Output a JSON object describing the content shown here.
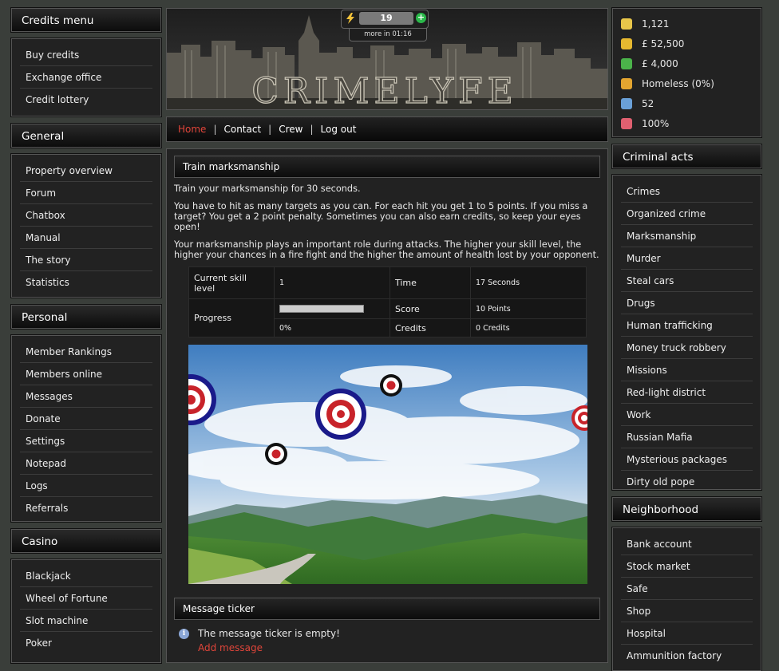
{
  "left": {
    "sections": [
      {
        "title": "Credits menu",
        "items": [
          "Buy credits",
          "Exchange office",
          "Credit lottery"
        ]
      },
      {
        "title": "General",
        "items": [
          "Property overview",
          "Forum",
          "Chatbox",
          "Manual",
          "The story",
          "Statistics"
        ]
      },
      {
        "title": "Personal",
        "items": [
          "Member Rankings",
          "Members online",
          "Messages",
          "Donate",
          "Settings",
          "Notepad",
          "Logs",
          "Referrals"
        ]
      },
      {
        "title": "Casino",
        "items": [
          "Blackjack",
          "Wheel of Fortune",
          "Slot machine",
          "Poker"
        ]
      }
    ]
  },
  "header": {
    "energy_value": "19",
    "energy_timer": "more in 01:16",
    "logo_text": "CRIMELYFE"
  },
  "nav": {
    "home": "Home",
    "contact": "Contact",
    "crew": "Crew",
    "logout": "Log out"
  },
  "main": {
    "title": "Train marksmanship",
    "p1": "Train your marksmanship for 30 seconds.",
    "p2": "You have to hit as many targets as you can. For each hit you get 1 to 5 points. If you miss a target? You get a 2 point penalty. Sometimes you can also earn credits, so keep your eyes open!",
    "p3": "Your marksmanship plays an important role during attacks. The higher your skill level, the higher your chances in a fire fight and the higher the amount of health lost by your opponent.",
    "table": {
      "skill_label": "Current skill level",
      "skill_value": "1",
      "time_label": "Time",
      "time_value": "17 Seconds",
      "progress_label": "Progress",
      "progress_value": "0%",
      "progress_fraction": 0.0,
      "score_label": "Score",
      "score_value": "10 Points",
      "credits_label": "Credits",
      "credits_value": "0 Credits"
    },
    "ticker_title": "Message ticker",
    "ticker_empty": "The message ticker is empty!",
    "add_message": "Add message"
  },
  "right": {
    "stats": [
      {
        "icon": "shield-icon",
        "color": "#e8c64a",
        "value": "1,121"
      },
      {
        "icon": "money-bag-icon",
        "color": "#e6b830",
        "value": "£ 52,500"
      },
      {
        "icon": "banknote-icon",
        "color": "#4bb34a",
        "value": "£ 4,000"
      },
      {
        "icon": "medal-icon",
        "color": "#e3a530",
        "value": "Homeless (0%)"
      },
      {
        "icon": "telephone-icon",
        "color": "#6aa0d8",
        "value": "52"
      },
      {
        "icon": "heart-icon",
        "color": "#e06070",
        "value": "100%"
      }
    ],
    "sections": [
      {
        "title": "Criminal acts",
        "items": [
          "Crimes",
          "Organized crime",
          "Marksmanship",
          "Murder",
          "Steal cars",
          "Drugs",
          "Human trafficking",
          "Money truck robbery",
          "Missions",
          "Red-light district",
          "Work",
          "Russian Mafia",
          "Mysterious packages",
          "Dirty old pope"
        ]
      },
      {
        "title": "Neighborhood",
        "items": [
          "Bank account",
          "Stock market",
          "Safe",
          "Shop",
          "Hospital",
          "Ammunition factory"
        ]
      }
    ]
  }
}
